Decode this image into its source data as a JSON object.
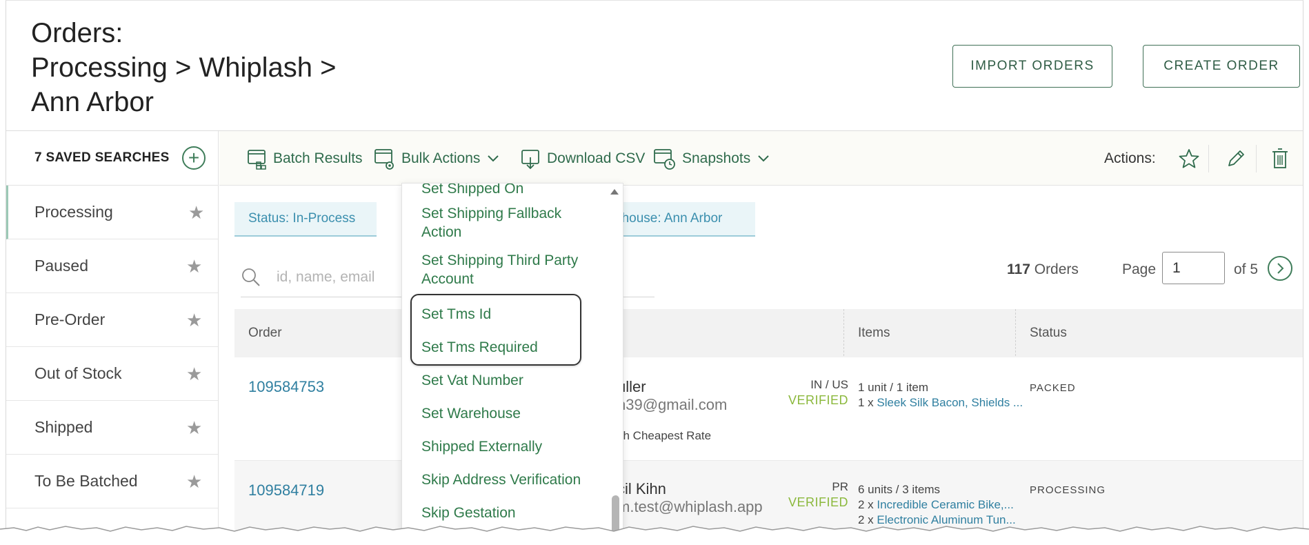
{
  "header": {
    "title_lines": [
      "Orders:",
      "Processing > Whiplash >",
      "Ann Arbor"
    ],
    "import_label": "IMPORT ORDERS",
    "create_label": "CREATE ORDER"
  },
  "sidebar": {
    "saved_label": "7 SAVED SEARCHES",
    "items": [
      {
        "label": "Processing"
      },
      {
        "label": "Paused"
      },
      {
        "label": "Pre-Order"
      },
      {
        "label": "Out of Stock"
      },
      {
        "label": "Shipped"
      },
      {
        "label": "To Be Batched"
      }
    ]
  },
  "toolbar": {
    "batch_results": "Batch Results",
    "bulk_actions": "Bulk Actions",
    "download_csv": "Download CSV",
    "snapshots": "Snapshots",
    "actions_label": "Actions:"
  },
  "filters": {
    "chip1": "Status: In-Process",
    "chip2": "ehouse: Ann Arbor"
  },
  "search": {
    "placeholder": "id, name, email"
  },
  "pagination": {
    "count": "117",
    "count_suffix": "Orders",
    "page_label": "Page",
    "page_value": "1",
    "of_label": "of 5"
  },
  "table": {
    "headers": {
      "order": "Order",
      "items": "Items",
      "status": "Status"
    },
    "rows": [
      {
        "order": "109584753",
        "name": "uller",
        "email": "n39@gmail.com",
        "ship": "sh Cheapest Rate",
        "country": "IN / US",
        "verified": "VERIFIED",
        "items_summary": "1 unit / 1 item",
        "item_lines": [
          {
            "qty": "1 x",
            "name": "Sleek Silk Bacon, Shields ..."
          }
        ],
        "status": "PACKED"
      },
      {
        "order": "109584719",
        "name": "cil Kihn",
        "email": "m.test@whiplash.app",
        "ship": "",
        "country": "PR",
        "verified": "VERIFIED",
        "items_summary": "6 units / 3 items",
        "item_lines": [
          {
            "qty": "2 x",
            "name": "Incredible Ceramic Bike,..."
          },
          {
            "qty": "2 x",
            "name": "Electronic Aluminum Tun..."
          }
        ],
        "status": "PROCESSING"
      }
    ]
  },
  "bulk_menu": {
    "items": [
      "Set Shipped On",
      "Set Shipping Fallback Action",
      "Set Shipping Third Party Account",
      "Set Tms Id",
      "Set Tms Required",
      "Set Vat Number",
      "Set Warehouse",
      "Shipped Externally",
      "Skip Address Verification",
      "Skip Gestation"
    ]
  },
  "colors": {
    "accent_green": "#2f6b4c",
    "link_blue": "#2f7fa0",
    "verified_green": "#8bb83c"
  }
}
